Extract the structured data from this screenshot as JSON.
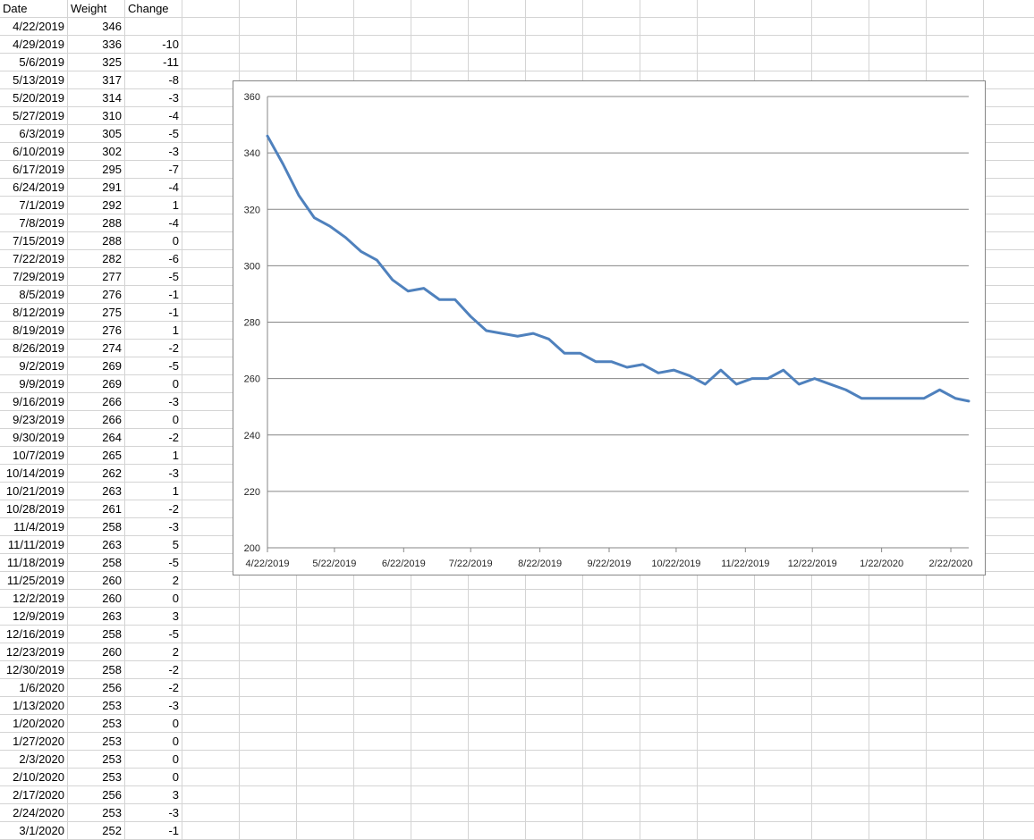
{
  "sheet": {
    "headers": {
      "date": "Date",
      "weight": "Weight",
      "change": "Change"
    },
    "rows": [
      {
        "date": "4/22/2019",
        "weight": "346",
        "change": ""
      },
      {
        "date": "4/29/2019",
        "weight": "336",
        "change": "-10"
      },
      {
        "date": "5/6/2019",
        "weight": "325",
        "change": "-11"
      },
      {
        "date": "5/13/2019",
        "weight": "317",
        "change": "-8"
      },
      {
        "date": "5/20/2019",
        "weight": "314",
        "change": "-3"
      },
      {
        "date": "5/27/2019",
        "weight": "310",
        "change": "-4"
      },
      {
        "date": "6/3/2019",
        "weight": "305",
        "change": "-5"
      },
      {
        "date": "6/10/2019",
        "weight": "302",
        "change": "-3"
      },
      {
        "date": "6/17/2019",
        "weight": "295",
        "change": "-7"
      },
      {
        "date": "6/24/2019",
        "weight": "291",
        "change": "-4"
      },
      {
        "date": "7/1/2019",
        "weight": "292",
        "change": "1"
      },
      {
        "date": "7/8/2019",
        "weight": "288",
        "change": "-4"
      },
      {
        "date": "7/15/2019",
        "weight": "288",
        "change": "0"
      },
      {
        "date": "7/22/2019",
        "weight": "282",
        "change": "-6"
      },
      {
        "date": "7/29/2019",
        "weight": "277",
        "change": "-5"
      },
      {
        "date": "8/5/2019",
        "weight": "276",
        "change": "-1"
      },
      {
        "date": "8/12/2019",
        "weight": "275",
        "change": "-1"
      },
      {
        "date": "8/19/2019",
        "weight": "276",
        "change": "1"
      },
      {
        "date": "8/26/2019",
        "weight": "274",
        "change": "-2"
      },
      {
        "date": "9/2/2019",
        "weight": "269",
        "change": "-5"
      },
      {
        "date": "9/9/2019",
        "weight": "269",
        "change": "0"
      },
      {
        "date": "9/16/2019",
        "weight": "266",
        "change": "-3"
      },
      {
        "date": "9/23/2019",
        "weight": "266",
        "change": "0"
      },
      {
        "date": "9/30/2019",
        "weight": "264",
        "change": "-2"
      },
      {
        "date": "10/7/2019",
        "weight": "265",
        "change": "1"
      },
      {
        "date": "10/14/2019",
        "weight": "262",
        "change": "-3"
      },
      {
        "date": "10/21/2019",
        "weight": "263",
        "change": "1"
      },
      {
        "date": "10/28/2019",
        "weight": "261",
        "change": "-2"
      },
      {
        "date": "11/4/2019",
        "weight": "258",
        "change": "-3"
      },
      {
        "date": "11/11/2019",
        "weight": "263",
        "change": "5"
      },
      {
        "date": "11/18/2019",
        "weight": "258",
        "change": "-5"
      },
      {
        "date": "11/25/2019",
        "weight": "260",
        "change": "2"
      },
      {
        "date": "12/2/2019",
        "weight": "260",
        "change": "0"
      },
      {
        "date": "12/9/2019",
        "weight": "263",
        "change": "3"
      },
      {
        "date": "12/16/2019",
        "weight": "258",
        "change": "-5"
      },
      {
        "date": "12/23/2019",
        "weight": "260",
        "change": "2"
      },
      {
        "date": "12/30/2019",
        "weight": "258",
        "change": "-2"
      },
      {
        "date": "1/6/2020",
        "weight": "256",
        "change": "-2"
      },
      {
        "date": "1/13/2020",
        "weight": "253",
        "change": "-3"
      },
      {
        "date": "1/20/2020",
        "weight": "253",
        "change": "0"
      },
      {
        "date": "1/27/2020",
        "weight": "253",
        "change": "0"
      },
      {
        "date": "2/3/2020",
        "weight": "253",
        "change": "0"
      },
      {
        "date": "2/10/2020",
        "weight": "253",
        "change": "0"
      },
      {
        "date": "2/17/2020",
        "weight": "256",
        "change": "3"
      },
      {
        "date": "2/24/2020",
        "weight": "253",
        "change": "-3"
      },
      {
        "date": "3/1/2020",
        "weight": "252",
        "change": "-1"
      }
    ]
  },
  "chart_data": {
    "type": "line",
    "title": "",
    "xlabel": "",
    "ylabel": "",
    "ylim": [
      200,
      360
    ],
    "y_ticks": [
      200,
      220,
      240,
      260,
      280,
      300,
      320,
      340,
      360
    ],
    "x_tick_labels": [
      "4/22/2019",
      "5/22/2019",
      "6/22/2019",
      "7/22/2019",
      "8/22/2019",
      "9/22/2019",
      "10/22/2019",
      "11/22/2019",
      "12/22/2019",
      "1/22/2020",
      "2/22/2020"
    ],
    "grid": "horizontal",
    "legend": "none",
    "series": [
      {
        "color": "#4f81bd",
        "x": [
          "4/22/2019",
          "4/29/2019",
          "5/6/2019",
          "5/13/2019",
          "5/20/2019",
          "5/27/2019",
          "6/3/2019",
          "6/10/2019",
          "6/17/2019",
          "6/24/2019",
          "7/1/2019",
          "7/8/2019",
          "7/15/2019",
          "7/22/2019",
          "7/29/2019",
          "8/5/2019",
          "8/12/2019",
          "8/19/2019",
          "8/26/2019",
          "9/2/2019",
          "9/9/2019",
          "9/16/2019",
          "9/23/2019",
          "9/30/2019",
          "10/7/2019",
          "10/14/2019",
          "10/21/2019",
          "10/28/2019",
          "11/4/2019",
          "11/11/2019",
          "11/18/2019",
          "11/25/2019",
          "12/2/2019",
          "12/9/2019",
          "12/16/2019",
          "12/23/2019",
          "12/30/2019",
          "1/6/2020",
          "1/13/2020",
          "1/20/2020",
          "1/27/2020",
          "2/3/2020",
          "2/10/2020",
          "2/17/2020",
          "2/24/2020",
          "3/1/2020"
        ],
        "values": [
          346,
          336,
          325,
          317,
          314,
          310,
          305,
          302,
          295,
          291,
          292,
          288,
          288,
          282,
          277,
          276,
          275,
          276,
          274,
          269,
          269,
          266,
          266,
          264,
          265,
          262,
          263,
          261,
          258,
          263,
          258,
          260,
          260,
          263,
          258,
          260,
          258,
          256,
          253,
          253,
          253,
          253,
          253,
          256,
          253,
          252
        ]
      }
    ]
  }
}
